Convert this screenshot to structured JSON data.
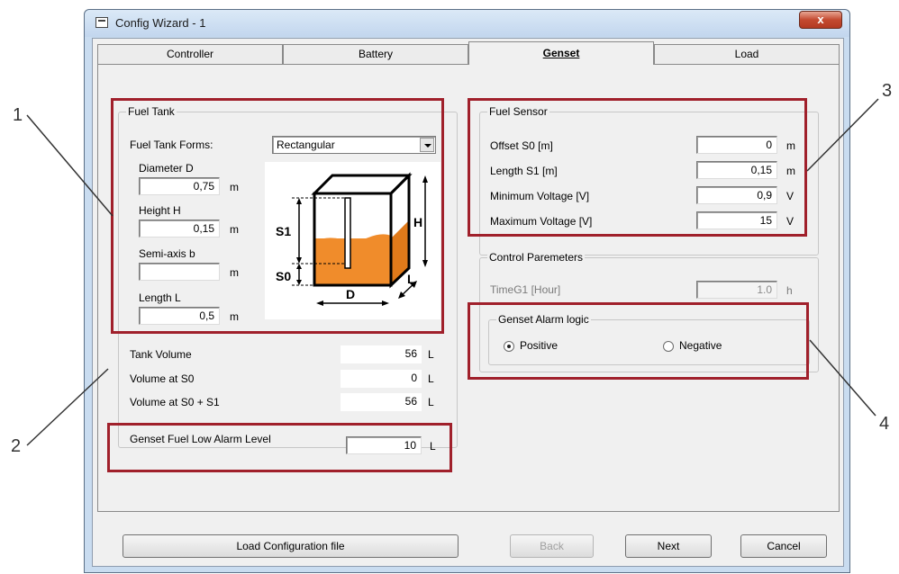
{
  "window": {
    "title": "Config Wizard - 1",
    "close_symbol": "x"
  },
  "tabs": [
    {
      "label": "Controller",
      "active": false
    },
    {
      "label": "Battery",
      "active": false
    },
    {
      "label": "Genset",
      "active": true
    },
    {
      "label": "Load",
      "active": false
    }
  ],
  "fuel_tank": {
    "group_title": "Fuel Tank",
    "forms_label": "Fuel Tank Forms:",
    "forms_value": "Rectangular",
    "diameter_label": "Diameter D",
    "diameter_value": "0,75",
    "height_label": "Height H",
    "height_value": "0,15",
    "semi_axis_label": "Semi-axis b",
    "semi_axis_value": "",
    "length_label": "Length L",
    "length_value": "0,5",
    "unit_m": "m",
    "diagram": {
      "s1": "S1",
      "s0": "S0",
      "h": "H",
      "d": "D",
      "l": "L"
    }
  },
  "volumes": {
    "tank_volume_label": "Tank Volume",
    "tank_volume_value": "56",
    "volume_s0_label": "Volume at S0",
    "volume_s0_value": "0",
    "volume_s0s1_label": "Volume at S0 + S1",
    "volume_s0s1_value": "56",
    "unit": "L"
  },
  "alarm_level": {
    "label": "Genset Fuel Low Alarm Level",
    "value": "10",
    "unit": "L"
  },
  "fuel_sensor": {
    "group_title": "Fuel Sensor",
    "offset_label": "Offset S0 [m]",
    "offset_value": "0",
    "offset_unit": "m",
    "length_label": "Length S1 [m]",
    "length_value": "0,15",
    "length_unit": "m",
    "min_voltage_label": "Minimum Voltage [V]",
    "min_voltage_value": "0,9",
    "min_voltage_unit": "V",
    "max_voltage_label": "Maximum Voltage [V]",
    "max_voltage_value": "15",
    "max_voltage_unit": "V"
  },
  "control_params": {
    "group_title": "Control Paremeters",
    "timeg1_label": "TimeG1 [Hour]",
    "timeg1_value": "1.0",
    "timeg1_unit": "h"
  },
  "alarm_logic": {
    "group_title": "Genset Alarm logic",
    "positive_label": "Positive",
    "negative_label": "Negative",
    "selected": "Positive"
  },
  "buttons": {
    "load_config": "Load Configuration file",
    "back": "Back",
    "next": "Next",
    "cancel": "Cancel"
  },
  "callouts": [
    "1",
    "2",
    "3",
    "4"
  ],
  "colors": {
    "highlight": "#a0202b",
    "fuel": "#f08c2b"
  }
}
